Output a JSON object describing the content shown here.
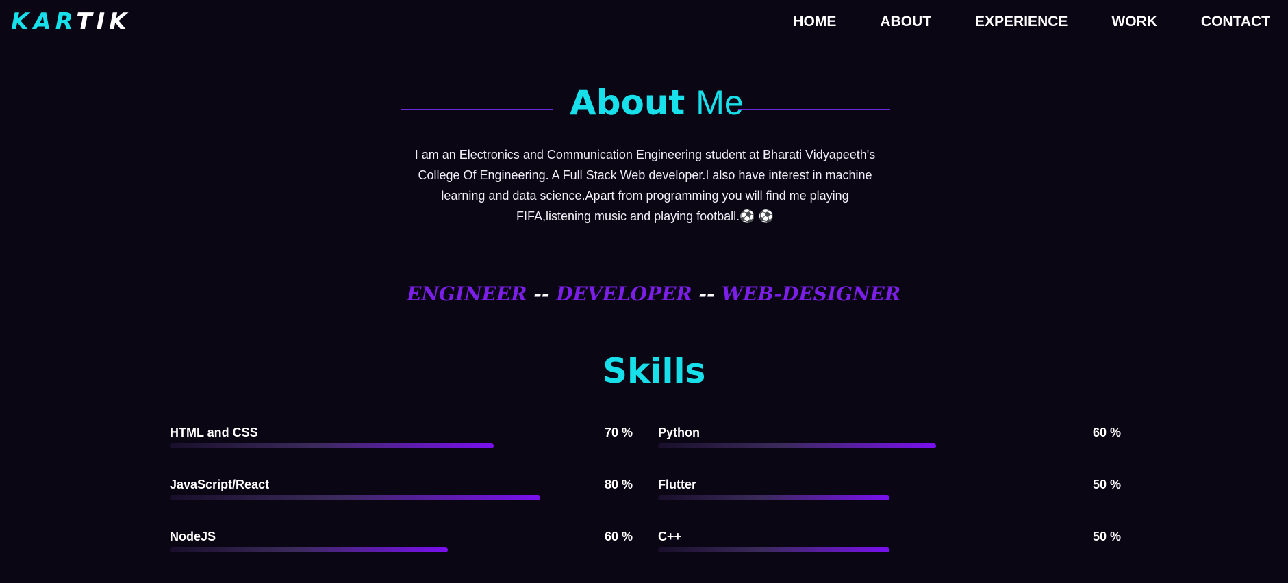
{
  "header": {
    "logo_accent": "KAR",
    "logo_plain": "TIK",
    "nav": [
      "HOME",
      "ABOUT",
      "EXPERIENCE",
      "WORK",
      "CONTACT"
    ]
  },
  "about": {
    "title_bold": "About",
    "title_light": "Me",
    "text": "I am an Electronics and Communication Engineering student at Bharati Vidyapeeth's College Of Engineering. A Full Stack Web developer.I also have interest in machine learning and data science.Apart from programming you will find me playing FIFA,listening music and playing football.⚽ ⚽",
    "roles": [
      "ENGINEER",
      "DEVELOPER",
      "WEB-DESIGNER"
    ],
    "role_separator": " -- "
  },
  "skills": {
    "title": "Skills",
    "items": [
      {
        "name": "HTML and CSS",
        "percent_label": "70 %",
        "level": 0.7
      },
      {
        "name": "Python",
        "percent_label": "60 %",
        "level": 0.6
      },
      {
        "name": "JavaScript/React",
        "percent_label": "80 %",
        "level": 0.8
      },
      {
        "name": "Flutter",
        "percent_label": "50 %",
        "level": 0.5
      },
      {
        "name": "NodeJS",
        "percent_label": "60 %",
        "level": 0.6
      },
      {
        "name": "C++",
        "percent_label": "50 %",
        "level": 0.5
      }
    ]
  },
  "colors": {
    "background": "#0a0614",
    "accent_cyan": "#17e0ea",
    "accent_purple": "#7b1fe8"
  }
}
